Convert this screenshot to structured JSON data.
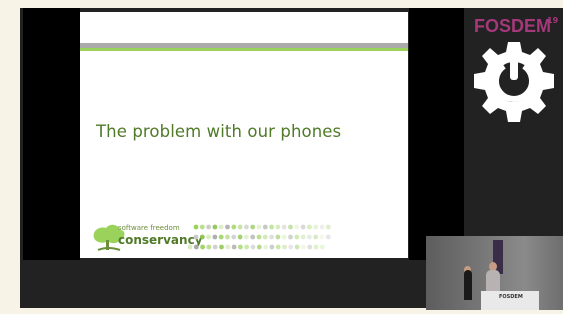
{
  "slide": {
    "title": "The problem with our phones",
    "logo": {
      "line1": "software freedom",
      "line2": "conservancy"
    }
  },
  "branding": {
    "name": "FOSDEM",
    "superscript": "19"
  },
  "pip": {
    "podium_text": "FOSDEM"
  },
  "colors": {
    "slide_accent": "#4f7a28",
    "bar_green": "#9bd25b",
    "fosdem_purple": "#a4387a"
  }
}
